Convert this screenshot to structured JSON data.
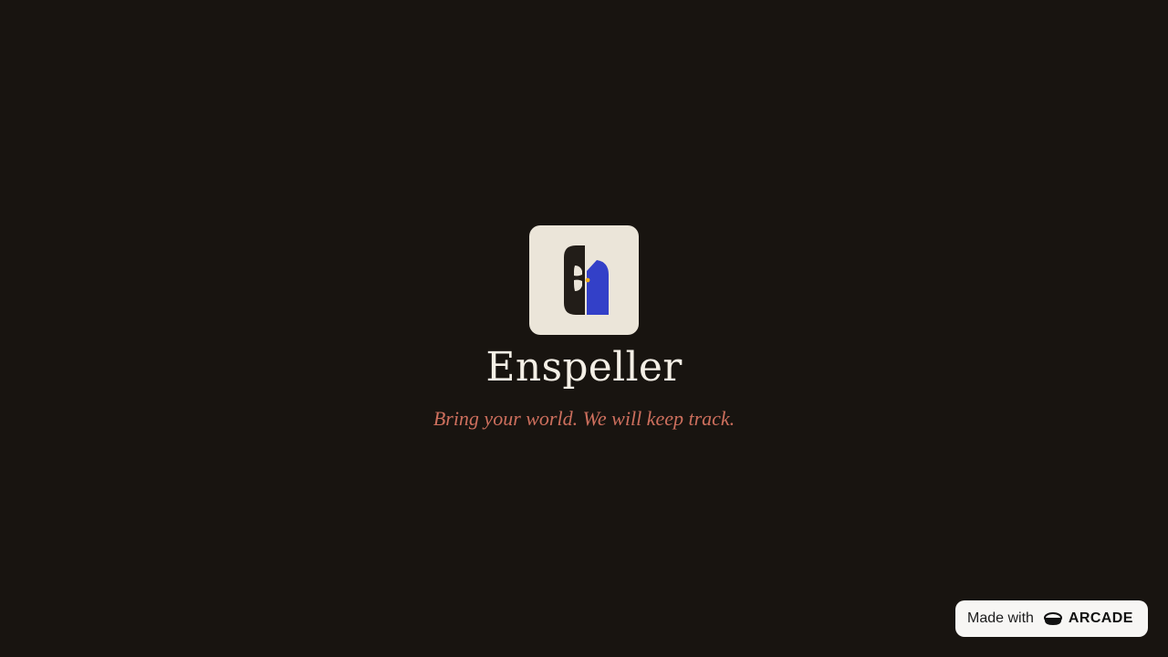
{
  "app": {
    "name": "Enspeller",
    "tagline": "Bring your world. We will keep track."
  },
  "logo": {
    "icon": "enspeller-logo-icon",
    "tile_color": "#ebe5d9",
    "dark_color": "#221d18",
    "accent_color": "#3340c8",
    "spark_color": "#f0b020"
  },
  "badge": {
    "prefix": "Made with",
    "brand": "ARCADE",
    "icon": "arcade-logo-icon"
  },
  "colors": {
    "background": "#181410",
    "title": "#f4efe6",
    "tagline": "#cd6f5d",
    "badge_bg": "#f7f6f4"
  }
}
